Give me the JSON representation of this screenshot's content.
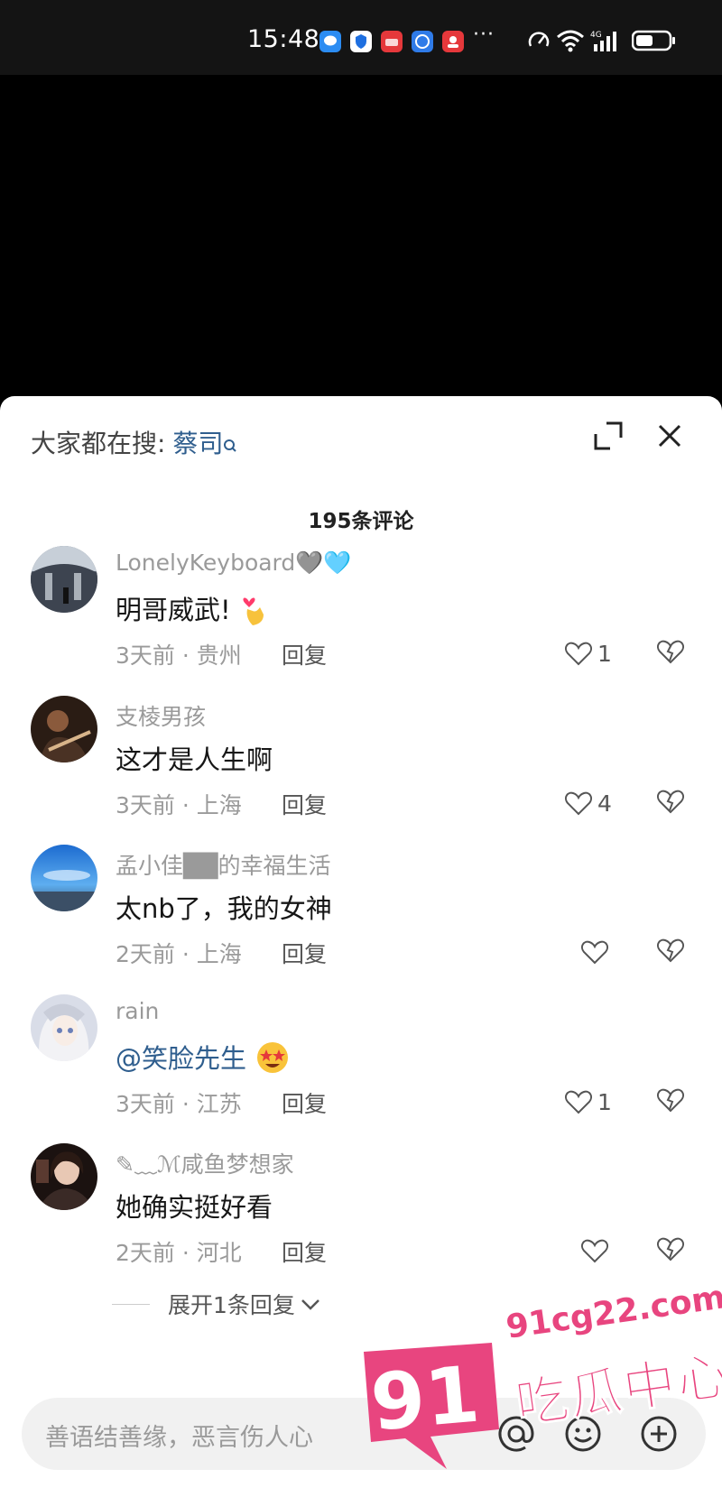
{
  "status_bar": {
    "time": "15:48",
    "more": "···",
    "network_label": "4G"
  },
  "sheet": {
    "search_prefix": "大家都在搜:",
    "search_keyword": "蔡司",
    "comment_count": "195条评论"
  },
  "comments": [
    {
      "user": "LonelyKeyboard🩶🩵",
      "text": "明哥威武!",
      "emoji": "heart-hands",
      "meta": "3天前 · 贵州",
      "reply": "回复",
      "likes": "1",
      "mention": false
    },
    {
      "user": "支棱男孩",
      "text": "这才是人生啊",
      "emoji": "",
      "meta": "3天前 · 上海",
      "reply": "回复",
      "likes": "4",
      "mention": false
    },
    {
      "user": "孟小佳██的幸福生活",
      "text": "太nb了，我的女神",
      "emoji": "",
      "meta": "2天前 · 上海",
      "reply": "回复",
      "likes": "",
      "mention": false
    },
    {
      "user": "rain",
      "text": "@笑脸先生",
      "emoji": "star-struck",
      "meta": "3天前 · 江苏",
      "reply": "回复",
      "likes": "1",
      "mention": true
    },
    {
      "user": "✎﹏ℳ咸鱼梦想家",
      "text": "她确实挺好看",
      "emoji": "",
      "meta": "2天前 · 河北",
      "reply": "回复",
      "likes": "",
      "mention": false
    }
  ],
  "expand_replies": "展开1条回复",
  "input": {
    "placeholder": "善语结善缘，恶言伤人心"
  },
  "watermark": {
    "badge": "91",
    "site": "91cg22.com",
    "title": "吃瓜中心"
  },
  "colors": {
    "accent_link": "#2f5e8e",
    "watermark_pink": "#e8457f"
  }
}
